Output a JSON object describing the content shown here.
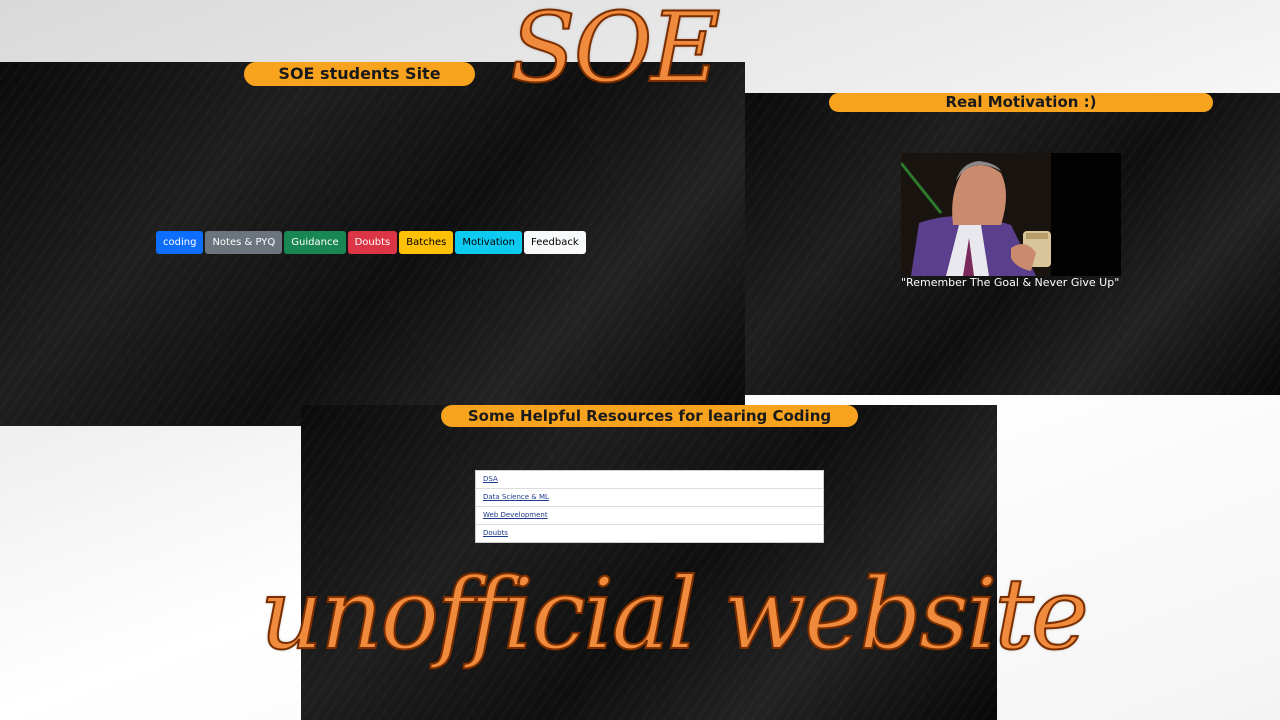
{
  "main_panel": {
    "title": "SOE students Site",
    "nav_buttons": [
      {
        "label": "coding",
        "variant": "primary",
        "color": "#0d6efd"
      },
      {
        "label": "Notes & PYQ",
        "variant": "secondary",
        "color": "#6c757d"
      },
      {
        "label": "Guidance",
        "variant": "success",
        "color": "#198754"
      },
      {
        "label": "Doubts",
        "variant": "danger",
        "color": "#dc3545"
      },
      {
        "label": "Batches",
        "variant": "warning",
        "color": "#ffc107"
      },
      {
        "label": "Motivation",
        "variant": "info",
        "color": "#0dcaf0"
      },
      {
        "label": "Feedback",
        "variant": "light",
        "color": "#f8f9fa"
      }
    ]
  },
  "motivation_panel": {
    "title": "Real Motivation :)",
    "image": "man-counting-money-gif",
    "quote": "\"Remember The Goal & Never Give Up\""
  },
  "resources_panel": {
    "title": "Some Helpful Resources for learing Coding",
    "items": [
      "DSA",
      "Data Science & ML",
      "Web Development",
      "Doubts"
    ]
  },
  "overlays": {
    "top": "SOE",
    "bottom": "unofficial website"
  },
  "colors": {
    "pill": "#f8a31e",
    "overlay_fill": "#f08a3c",
    "overlay_stroke": "#7a2e00"
  }
}
